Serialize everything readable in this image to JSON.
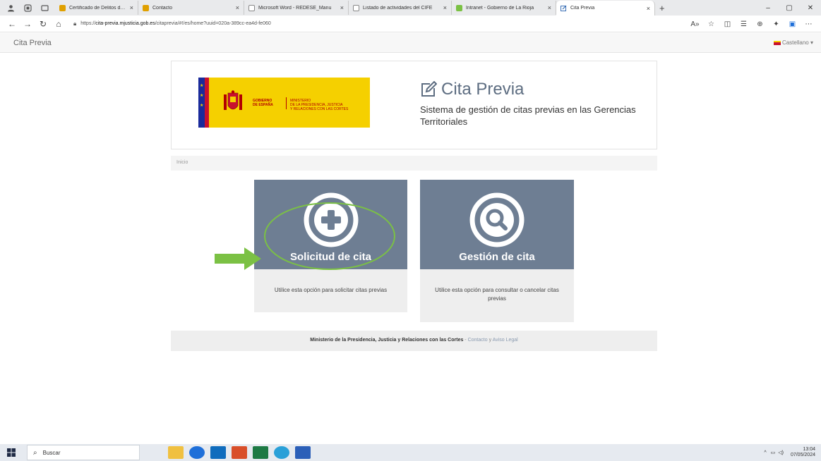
{
  "browser": {
    "tabs": [
      {
        "label": "Certificado de Delitos de Natural",
        "color": "#e0a000"
      },
      {
        "label": "Contacto",
        "color": "#e0a000"
      },
      {
        "label": "Microsoft Word - REDESE_Manu",
        "color": "#888888"
      },
      {
        "label": "Listado de actividades del CIFE",
        "color": "#888888"
      },
      {
        "label": "Intranet - Gobierno de La Rioja",
        "color": "#7bc144"
      },
      {
        "label": "Cita Previa",
        "color": "#3a6fb5"
      }
    ],
    "url_prefix": "https://",
    "url_host": "cita-previa.mjusticia.gob.es",
    "url_path": "/citaprevia/#!/es/home?uuid=020a-389cc-ea4d-fe060",
    "tab_close": "×",
    "new_tab": "+",
    "window_controls": [
      "–",
      "▢",
      "✕"
    ]
  },
  "app": {
    "brand": "Cita Previa",
    "language": "Castellano ▾"
  },
  "header": {
    "logo_gobierno": "GOBIERNO\nDE ESPAÑA",
    "logo_ministerio": "MINISTERIO\nDE LA PRESIDENCIA, JUSTICIA\nY RELACIONES CON LAS CORTES",
    "title": "Cita Previa",
    "subtitle": "Sistema de gestión de citas previas en las Gerencias Territoriales"
  },
  "breadcrumb": {
    "label": "Inicio"
  },
  "cards": [
    {
      "title": "Solicitud de cita",
      "description": "Utilice esta opción para solicitar citas previas"
    },
    {
      "title": "Gestión de cita",
      "description": "Utilice esta opción para consultar o cancelar citas previas"
    }
  ],
  "footer": {
    "ministry": "Ministerio de la Presidencia, Justicia y Relaciones con las Cortes",
    "separator": " - ",
    "contact": "Contacto",
    "and": " y ",
    "legal": "Aviso Legal"
  },
  "taskbar": {
    "search_placeholder": "Buscar",
    "time": "13:04",
    "date": "07/05/2024"
  },
  "colors": {
    "card_top": "#6e7e93",
    "annotation_green": "#7bc144",
    "logo_yellow": "#f5d000"
  }
}
